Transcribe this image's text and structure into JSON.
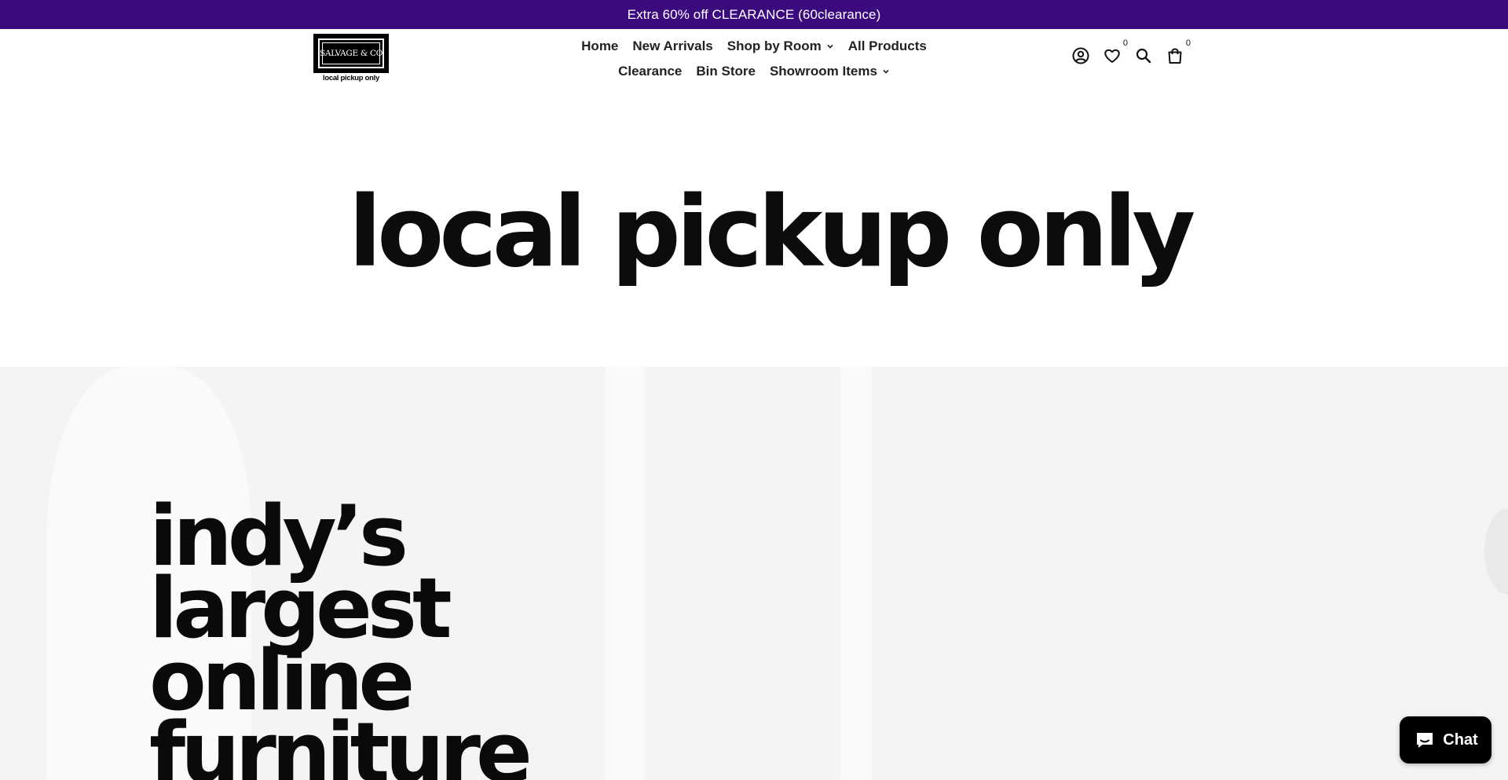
{
  "announcement": {
    "text": "Extra 60% off CLEARANCE (60clearance)"
  },
  "colors": {
    "announcement_bg": "#3b0b7e",
    "chat_bg": "#000000",
    "hero_bg": "#f4f4f3"
  },
  "logo": {
    "name": "SALVAGE & CO",
    "tagline": "local pickup only"
  },
  "nav": {
    "row1": [
      {
        "label": "Home",
        "has_dropdown": false
      },
      {
        "label": "New Arrivals",
        "has_dropdown": false
      },
      {
        "label": "Shop by Room",
        "has_dropdown": true
      },
      {
        "label": "All Products",
        "has_dropdown": false
      }
    ],
    "row2": [
      {
        "label": "Clearance",
        "has_dropdown": false
      },
      {
        "label": "Bin Store",
        "has_dropdown": false
      },
      {
        "label": "Showroom Items",
        "has_dropdown": true
      }
    ]
  },
  "header_icons": {
    "account": "account-icon",
    "wishlist": "heart-icon",
    "wishlist_count": "0",
    "search": "search-icon",
    "cart": "bag-icon",
    "cart_count": "0"
  },
  "hero_banner": {
    "text": "local pickup only"
  },
  "hero_slide": {
    "lines": [
      "indy’s",
      "largest",
      "online",
      "furniture"
    ]
  },
  "chat": {
    "label": "Chat"
  }
}
